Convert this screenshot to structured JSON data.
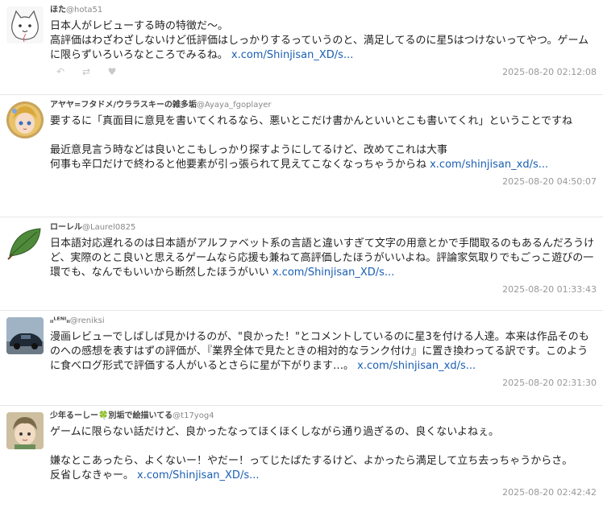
{
  "tweets": [
    {
      "name": "ほた",
      "handle": "@hota51",
      "text": "日本人がレビューする時の特徴だ〜。\n高評価はわざわざしないけど低評価はしっかりするっていうのと、満足してるのに星5はつけないってやつ。ゲームに限らずいろいろなところでみるね。 ",
      "link": "x.com/Shinjisan_XD/s...",
      "timestamp": "2025-08-20 02:12:08",
      "avatar_icon": "cat-sketch-avatar"
    },
    {
      "name": "アヤヤ=フタドメ/ウララスキーの雑多垢",
      "handle": "@Ayaya_fgoplayer",
      "text": "要するに「真面目に意見を書いてくれるなら、悪いとこだけ書かんといいとこも書いてくれ」ということですね\n\n最近意見言う時などは良いとこもしっかり探すようにしてるけど、改めてこれは大事\n何事も辛口だけで終わると他要素が引っ張られて見えてこなくなっちゃうからね ",
      "link": "x.com/shinjisan_xd/s...",
      "timestamp": "2025-08-20 04:50:07",
      "avatar_icon": "anime-girl-avatar"
    },
    {
      "name": "ローレル",
      "handle": "@Laurel0825",
      "text": "日本語対応遅れるのは日本語がアルファベット系の言語と違いすぎて文字の用意とかで手間取るのもあるんだろうけど、実際のとこ良いと思えるゲームなら応援も兼ねて高評価したほうがいいよね。評論家気取りでもごっこ遊びの一環でも、なんでもいいから断然したほうがいい ",
      "link": "x.com/Shinjisan_XD/s...",
      "timestamp": "2025-08-20 01:33:43",
      "avatar_icon": "leaf-avatar"
    },
    {
      "name": "ᵢᵢᴸᴱᴺᴵᵢᵢ",
      "handle": "@reniksi",
      "text": "漫画レビューでしばしば見かけるのが、\"良かった！\"とコメントしているのに星3を付ける人達。本来は作品そのものへの感想を表すはずの評価が、『業界全体で見たときの相対的なランク付け』に置き換わってる訳です。このように食べログ形式で評価する人がいるとさらに星が下がります…。 ",
      "link": "x.com/shinjisan_xd/s...",
      "timestamp": "2025-08-20 02:31:30",
      "avatar_icon": "car-avatar"
    },
    {
      "name": "少年るーしー🍀別垢で絵描いてる",
      "handle": "@t17yog4",
      "text": "ゲームに限らない話だけど、良かったなってほくほくしながら通り過ぎるの、良くないよねぇ。\n\n嫌なとこあったら、よくないー！やだー！ってじたばたするけど、よかったら満足して立ち去っちゃうからさ。\n反省しなきゃー。 ",
      "link": "x.com/Shinjisan_XD/s...",
      "timestamp": "2025-08-20 02:42:42",
      "avatar_icon": "anime-boy-avatar"
    }
  ],
  "actions": {
    "reply_icon": "reply-icon",
    "retweet_icon": "retweet-icon",
    "like_icon": "heart-icon"
  },
  "colors": {
    "link": "#1a5fb4",
    "timestamp": "#999999",
    "divider": "#e6e6e6"
  }
}
